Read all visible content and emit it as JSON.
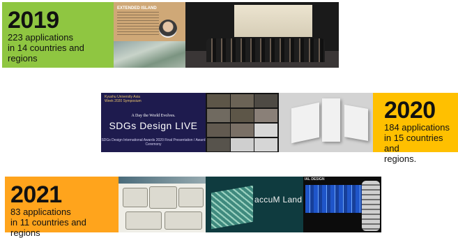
{
  "entries": [
    {
      "year": "2019",
      "line1": "223 applications",
      "line2": "in 14 countries and regions"
    },
    {
      "year": "2020",
      "line1": "184 applications",
      "line2": "in 15 countries and",
      "line3": "regions."
    },
    {
      "year": "2021",
      "line1": "83 applications",
      "line2": "in 11 countries and regions"
    }
  ],
  "photos": {
    "poster_2019": {
      "title": "EXTENDED ISLAND"
    },
    "slide_2020": {
      "institution": "Kyushu University Asia Week 2020 Symposium",
      "tagline": "A Day the World Evolves.",
      "title": "SDGs Design LIVE",
      "subtitle": "SDGs Design International Awards 2020 Final Presentation / Award Ceremony"
    },
    "land_2021": {
      "title": "accuM Land"
    },
    "drawing_2021": {
      "label": "IAL DESIGN"
    }
  },
  "colors": {
    "green_2019": "#8fc641",
    "yellow_2020": "#ffc000",
    "orange_2021": "#ffa41c"
  }
}
